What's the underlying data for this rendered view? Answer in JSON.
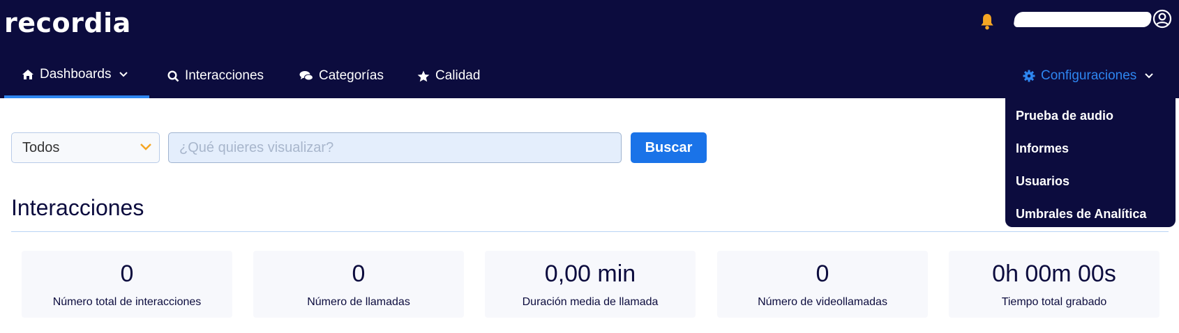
{
  "app": {
    "logo_text": "recordia"
  },
  "header": {
    "notifications_icon": "bell-icon",
    "bell_color": "#f5a623",
    "user_icon": "user-circle-icon",
    "user_name": ""
  },
  "nav": {
    "items": [
      {
        "label": "Dashboards",
        "icon": "home-icon"
      },
      {
        "label": "Interacciones",
        "icon": "search-icon"
      },
      {
        "label": "Categorías",
        "icon": "chat-icon"
      },
      {
        "label": "Calidad",
        "icon": "star-icon"
      }
    ],
    "config": {
      "label": "Configuraciones",
      "icon": "gear-icon"
    }
  },
  "config_menu": {
    "items": [
      {
        "label": "Prueba de audio"
      },
      {
        "label": "Informes"
      },
      {
        "label": "Usuarios"
      },
      {
        "label": "Umbrales de Analítica"
      }
    ]
  },
  "filter": {
    "selected": "Todos"
  },
  "search": {
    "placeholder": "¿Qué quieres visualizar?",
    "value": "",
    "button_label": "Buscar"
  },
  "section": {
    "title": "Interacciones"
  },
  "stats": [
    {
      "value": "0",
      "label": "Número total de interacciones"
    },
    {
      "value": "0",
      "label": "Número de llamadas"
    },
    {
      "value": "0,00 min",
      "label": "Duración media de llamada"
    },
    {
      "value": "0",
      "label": "Número de videollamadas"
    },
    {
      "value": "0h 00m 00s",
      "label": "Tiempo total grabado"
    }
  ],
  "colors": {
    "navy": "#0c0c3e",
    "accent": "#2e86f0",
    "button": "#1a73e8"
  }
}
